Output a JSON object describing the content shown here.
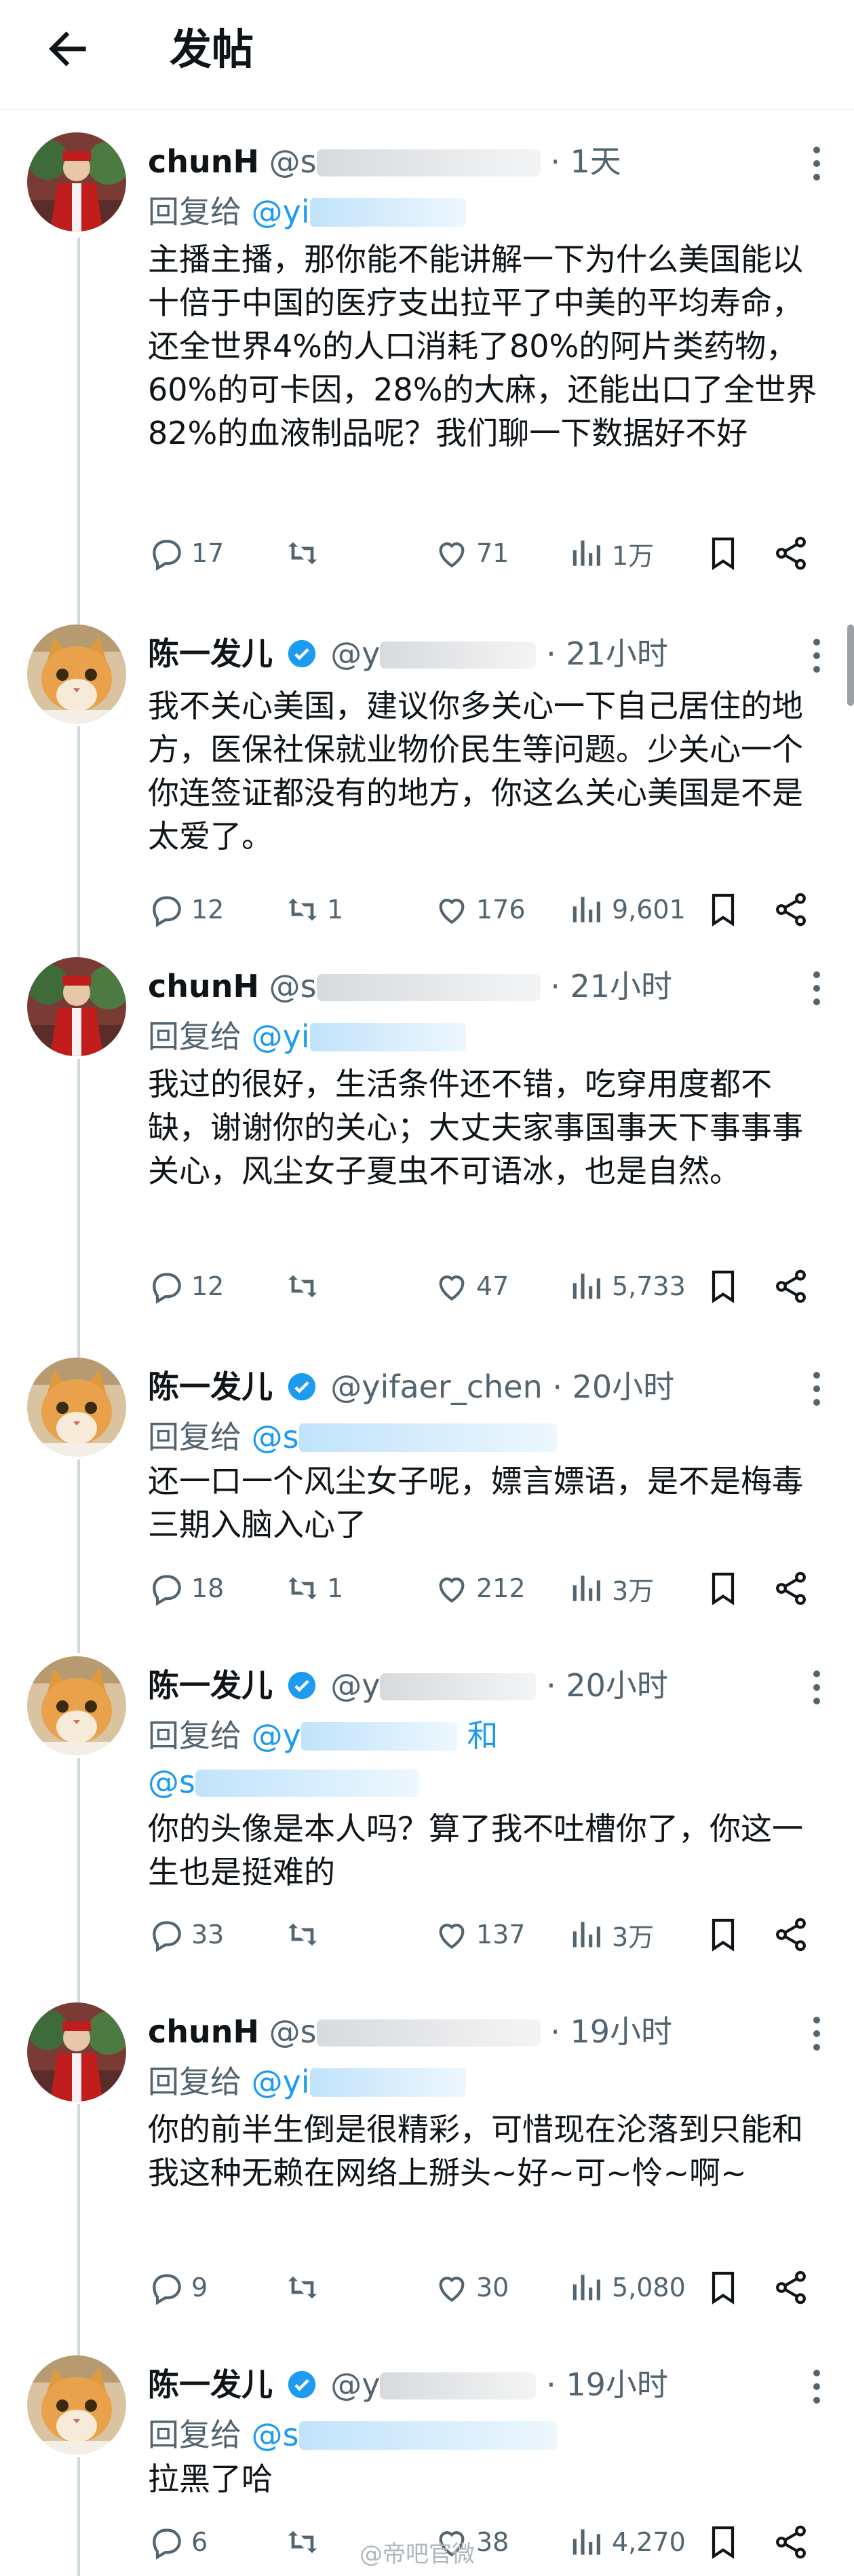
{
  "header": {
    "title": "发帖"
  },
  "posts": [
    {
      "name": "chunH",
      "handle": "@s",
      "time": "· 1天",
      "reply_label": "回复给",
      "reply_mention": "@yi",
      "body": "主播主播，那你能不能讲解一下为什么美国能以十倍于中国的医疗支出拉平了中美的平均寿命，还全世界4%的人口消耗了80%的阿片类药物，60%的可卡因，28%的大麻，还能出口了全世界82%的血液制品呢？我们聊一下数据好不好",
      "replies": "17",
      "reposts": "",
      "likes": "71",
      "views": "1万"
    },
    {
      "name": "陈一发儿",
      "handle": "@y",
      "time": "· 21小时",
      "body": "我不关心美国，建议你多关心一下自己居住的地方，医保社保就业物价民生等问题。少关心一个你连签证都没有的地方，你这么关心美国是不是太爱了。",
      "replies": "12",
      "reposts": "1",
      "likes": "176",
      "views": "9,601"
    },
    {
      "name": "chunH",
      "handle": "@s",
      "time": "· 21小时",
      "reply_label": "回复给",
      "reply_mention": "@yi",
      "body": "我过的很好，生活条件还不错，吃穿用度都不缺，谢谢你的关心；大丈夫家事国事天下事事事关心，风尘女子夏虫不可语冰，也是自然。",
      "replies": "12",
      "reposts": "",
      "likes": "47",
      "views": "5,733"
    },
    {
      "name": "陈一发儿",
      "handle": "@yifaer_chen",
      "time": "· 20小时",
      "reply_label": "回复给",
      "reply_mention": "@s",
      "body": "还一口一个风尘女子呢，嫖言嫖语，是不是梅毒三期入脑入心了",
      "replies": "18",
      "reposts": "1",
      "likes": "212",
      "views": "3万"
    },
    {
      "name": "陈一发儿",
      "handle": "@y",
      "time": "· 20小时",
      "reply_label": "回复给",
      "reply_mention": "@y",
      "reply_and": "和",
      "reply_mention2": "@s",
      "body": "你的头像是本人吗？算了我不吐槽你了，你这一生也是挺难的",
      "replies": "33",
      "reposts": "",
      "likes": "137",
      "views": "3万"
    },
    {
      "name": "chunH",
      "handle": "@s",
      "time": "· 19小时",
      "reply_label": "回复给",
      "reply_mention": "@yi",
      "body": "你的前半生倒是很精彩，可惜现在沦落到只能和我这种无赖在网络上掰头~好~可~怜~啊~",
      "replies": "9",
      "reposts": "",
      "likes": "30",
      "views": "5,080"
    },
    {
      "name": "陈一发儿",
      "handle": "@y",
      "time": "· 19小时",
      "reply_label": "回复给",
      "reply_mention": "@s",
      "body": "拉黑了哈",
      "replies": "6",
      "reposts": "",
      "likes": "38",
      "views": "4,270"
    }
  ],
  "watermark": "@帝吧官微",
  "icons": [
    "back-arrow-icon",
    "verified-badge-icon",
    "more-vertical-icon",
    "reply-icon",
    "repost-icon",
    "like-icon",
    "views-icon",
    "bookmark-icon",
    "share-icon"
  ],
  "colors": {
    "accent": "#1d9bf0",
    "secondary_text": "#536471",
    "thread_line": "#cfd9de"
  }
}
